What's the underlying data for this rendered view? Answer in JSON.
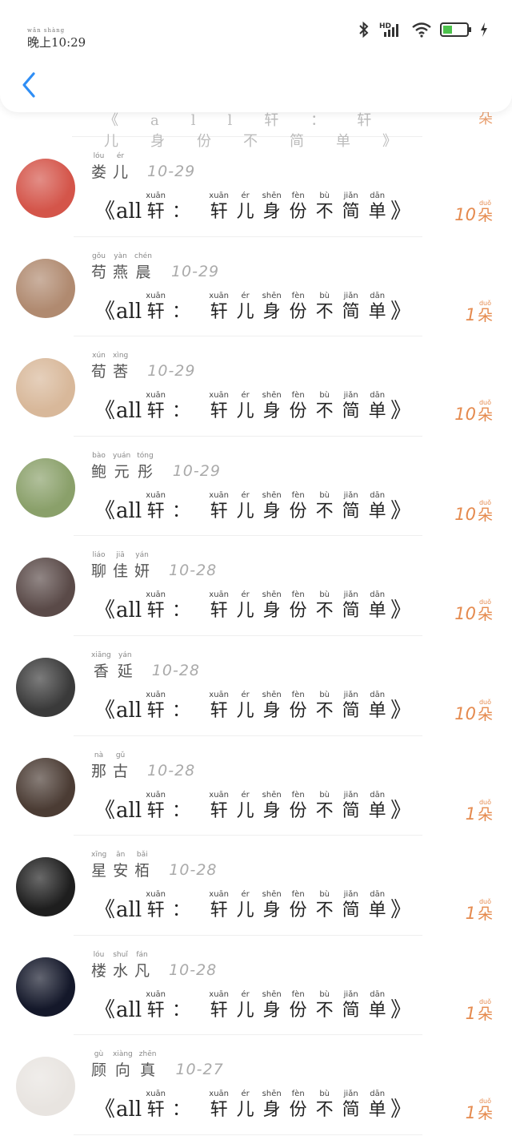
{
  "status_bar": {
    "time_pinyin": "wǎn shàng",
    "time": "晚上10:29",
    "network_label": "HD",
    "icons": [
      "bluetooth-icon",
      "signal-icon",
      "wifi-icon",
      "battery-icon",
      "charging-icon"
    ]
  },
  "header": {
    "back_icon": "chevron-left-icon"
  },
  "partial_row": {
    "text": "《all轩：轩儿身份不简单》",
    "amount": "朵"
  },
  "gift_text": {
    "open": "《",
    "latin": "all",
    "chars": [
      {
        "py": "xuān",
        "hz": "轩"
      },
      {
        "py": "",
        "hz": "："
      },
      {
        "py": "xuān",
        "hz": "轩"
      },
      {
        "py": "ér",
        "hz": "儿"
      },
      {
        "py": "shēn",
        "hz": "身"
      },
      {
        "py": "fèn",
        "hz": "份"
      },
      {
        "py": "bù",
        "hz": "不"
      },
      {
        "py": "jiǎn",
        "hz": "简"
      },
      {
        "py": "dān",
        "hz": "单"
      }
    ],
    "close": "》"
  },
  "unit": {
    "py": "duǒ",
    "hz": "朵"
  },
  "rows": [
    {
      "name": [
        {
          "py": "lóu",
          "hz": "娄"
        },
        {
          "py": "ér",
          "hz": "儿"
        }
      ],
      "date": "10-29",
      "amount": "10",
      "avatar_color": "#d4554a"
    },
    {
      "name": [
        {
          "py": "gǒu",
          "hz": "苟"
        },
        {
          "py": "yàn",
          "hz": "燕"
        },
        {
          "py": "chén",
          "hz": "晨"
        }
      ],
      "date": "10-29",
      "amount": "1",
      "avatar_color": "#b08a70"
    },
    {
      "name": [
        {
          "py": "xún",
          "hz": "荀"
        },
        {
          "py": "xìng",
          "hz": "莕"
        }
      ],
      "date": "10-29",
      "amount": "10",
      "avatar_color": "#d8b89a"
    },
    {
      "name": [
        {
          "py": "bào",
          "hz": "鲍"
        },
        {
          "py": "yuán",
          "hz": "元"
        },
        {
          "py": "tóng",
          "hz": "彤"
        }
      ],
      "date": "10-29",
      "amount": "10",
      "avatar_color": "#8aa06a"
    },
    {
      "name": [
        {
          "py": "liáo",
          "hz": "聊"
        },
        {
          "py": "jiā",
          "hz": "佳"
        },
        {
          "py": "yán",
          "hz": "妍"
        }
      ],
      "date": "10-28",
      "amount": "10",
      "avatar_color": "#5a4a48"
    },
    {
      "name": [
        {
          "py": "xiāng",
          "hz": "香"
        },
        {
          "py": "yán",
          "hz": "延"
        }
      ],
      "date": "10-28",
      "amount": "10",
      "avatar_color": "#3a3a3a"
    },
    {
      "name": [
        {
          "py": "nà",
          "hz": "那"
        },
        {
          "py": "gǔ",
          "hz": "古"
        }
      ],
      "date": "10-28",
      "amount": "1",
      "avatar_color": "#4b3c34"
    },
    {
      "name": [
        {
          "py": "xīng",
          "hz": "星"
        },
        {
          "py": "ān",
          "hz": "安"
        },
        {
          "py": "bǎi",
          "hz": "栢"
        }
      ],
      "date": "10-28",
      "amount": "1",
      "avatar_color": "#1e1e1e"
    },
    {
      "name": [
        {
          "py": "lóu",
          "hz": "楼"
        },
        {
          "py": "shuǐ",
          "hz": "水"
        },
        {
          "py": "fán",
          "hz": "凡"
        }
      ],
      "date": "10-28",
      "amount": "1",
      "avatar_color": "#14182a"
    },
    {
      "name": [
        {
          "py": "gù",
          "hz": "顾"
        },
        {
          "py": "xiàng",
          "hz": "向"
        },
        {
          "py": "zhēn",
          "hz": "真"
        }
      ],
      "date": "10-27",
      "amount": "1",
      "avatar_color": "#e8e4e0"
    }
  ]
}
